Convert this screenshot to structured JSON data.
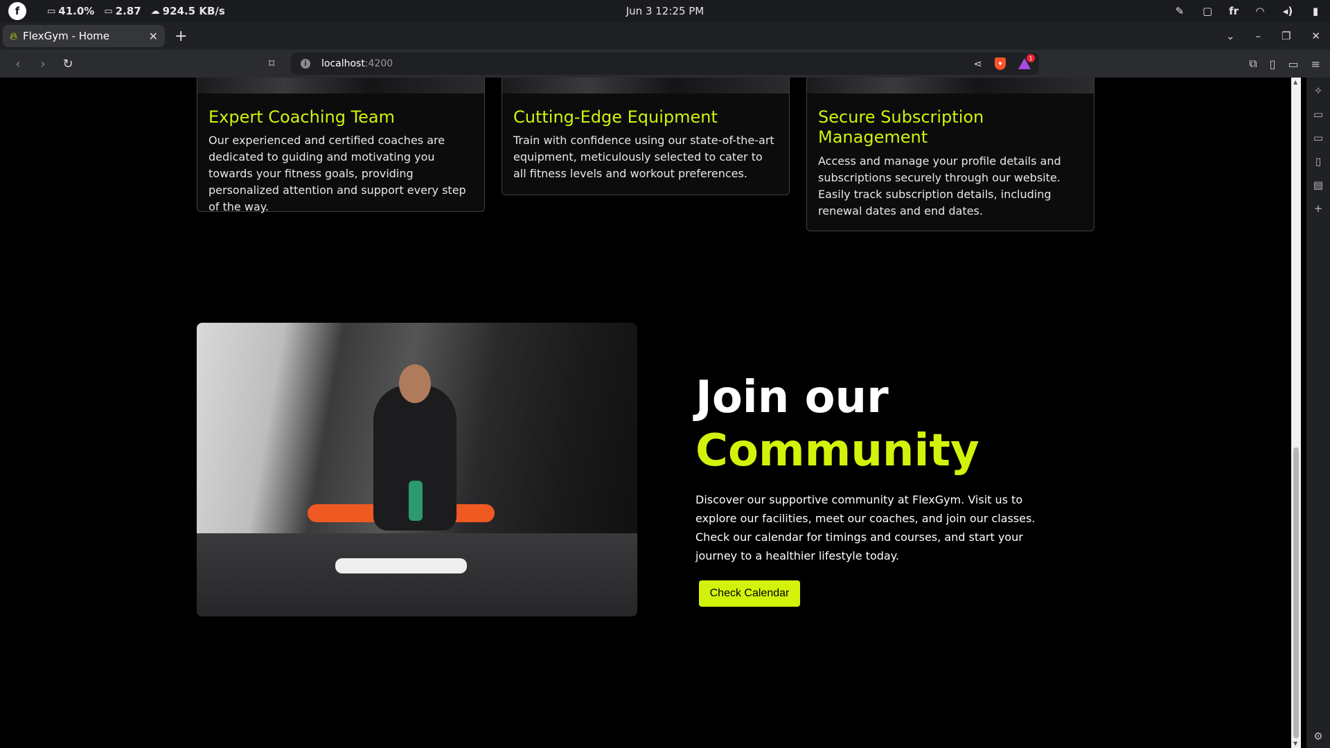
{
  "os": {
    "battery": "41.0%",
    "load": "2.87",
    "net": "924.5 KB/s",
    "datetime": "Jun 3  12:25 PM",
    "lang": "fr"
  },
  "browser": {
    "tab_title": "FlexGym - Home",
    "url_host": "localhost",
    "url_port": ":4200",
    "rewards_badge": "1"
  },
  "features": [
    {
      "title": "Expert Coaching Team",
      "text": "Our experienced and certified coaches are dedicated to guiding and motivating you towards your fitness goals, providing personalized attention and support every step of the way."
    },
    {
      "title": "Cutting-Edge Equipment",
      "text": "Train with confidence using our state-of-the-art equipment, meticulously selected to cater to all fitness levels and workout preferences."
    },
    {
      "title": "Secure Subscription Management",
      "text": "Access and manage your profile details and subscriptions securely through our website. Easily track subscription details, including renewal dates and end dates."
    }
  ],
  "community": {
    "title_line1": "Join our",
    "title_line2": "Community",
    "description": "Discover our supportive community at FlexGym. Visit us to explore our facilities, meet our coaches, and join our classes. Check our calendar for timings and courses, and start your journey to a healthier lifestyle today.",
    "button_label": "Check Calendar"
  },
  "colors": {
    "accent": "#d3f20b",
    "background": "#000000",
    "card_border": "#404046"
  }
}
